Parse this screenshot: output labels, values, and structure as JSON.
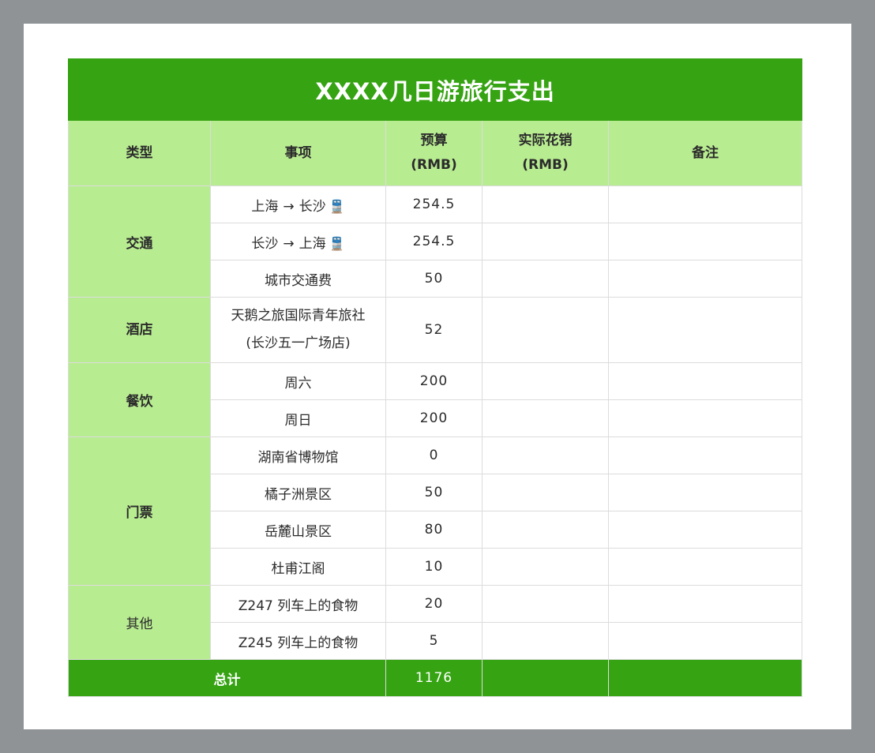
{
  "title": "XXXX几日游旅行支出",
  "headers": {
    "type": "类型",
    "item": "事项",
    "budget_line1": "预算",
    "budget_line2": "(RMB)",
    "actual_line1": "实际花销",
    "actual_line2": "(RMB)",
    "note": "备注"
  },
  "categories": {
    "transport": "交通",
    "hotel": "酒店",
    "food": "餐饮",
    "tickets": "门票",
    "other": "其他"
  },
  "rows": [
    {
      "from": "上海",
      "arrow": "→",
      "to": "长沙",
      "icon": "train-icon",
      "budget": "254.5"
    },
    {
      "from": "长沙",
      "arrow": "→",
      "to": "上海",
      "icon": "train-icon",
      "budget": "254.5"
    },
    {
      "item": "城市交通费",
      "budget": "50"
    },
    {
      "item_line1": "天鹅之旅国际青年旅社",
      "item_line2": "(长沙五一广场店)",
      "budget": "52"
    },
    {
      "item": "周六",
      "budget": "200"
    },
    {
      "item": "周日",
      "budget": "200"
    },
    {
      "item": "湖南省博物馆",
      "budget": "0"
    },
    {
      "item": "橘子洲景区",
      "budget": "50"
    },
    {
      "item": "岳麓山景区",
      "budget": "80"
    },
    {
      "item": "杜甫江阁",
      "budget": "10"
    },
    {
      "item": "Z247 列车上的食物",
      "budget": "20"
    },
    {
      "item": "Z245 列车上的食物",
      "budget": "5"
    }
  ],
  "total": {
    "label": "总计",
    "budget": "1176"
  },
  "colors": {
    "title_bg": "#35a312",
    "header_bg": "#b8ec91",
    "total_bg": "#35a312"
  }
}
